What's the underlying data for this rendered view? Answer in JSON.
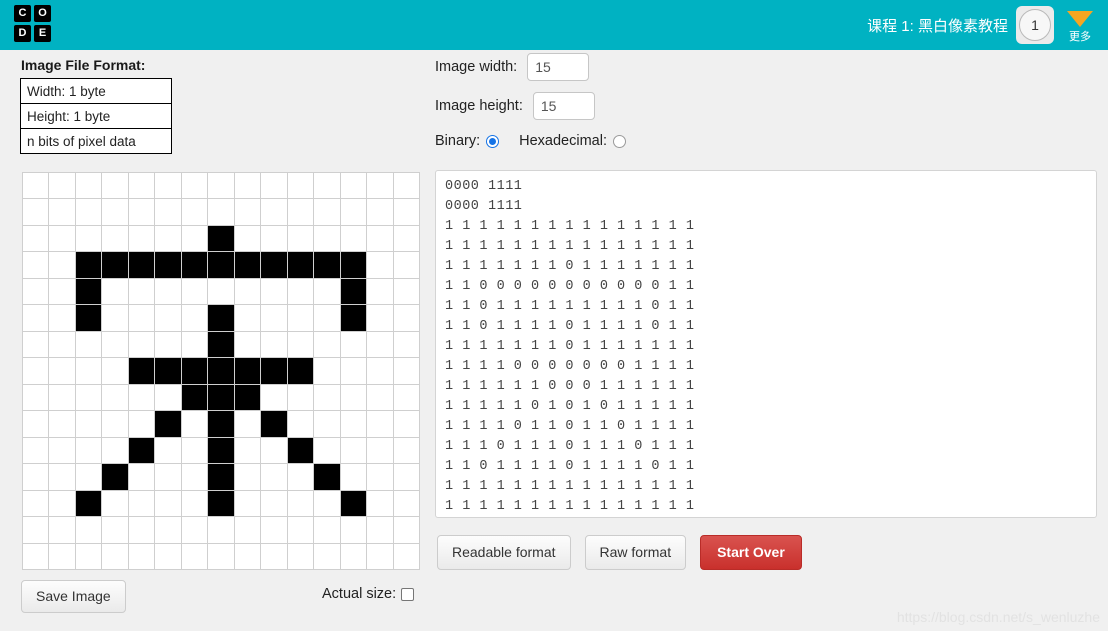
{
  "header": {
    "logo_letters": [
      "C",
      "O",
      "D",
      "E"
    ],
    "lesson_title": "课程 1: 黑白像素教程",
    "lesson_number": "1",
    "more_label": "更多",
    "background_color": "#00b2c2",
    "caret_color": "#f5a623"
  },
  "left_panel": {
    "format_title": "Image File Format:",
    "format_rows": [
      "Width: 1 byte",
      "Height: 1 byte",
      "n bits of pixel data"
    ],
    "save_image_label": "Save Image",
    "actual_size_label": "Actual size:",
    "actual_size_checked": false
  },
  "right_panel": {
    "width_label": "Image width:",
    "width_value": "15",
    "height_label": "Image height:",
    "height_value": "15",
    "binary_label": "Binary:",
    "hexadecimal_label": "Hexadecimal:",
    "binary_selected": true,
    "hexadecimal_selected": false,
    "buttons": {
      "readable_format": "Readable format",
      "raw_format": "Raw format",
      "start_over": "Start Over",
      "start_over_color": "#c9302c"
    }
  },
  "binary_output": {
    "header_lines": [
      "0000 1111",
      "0000 1111"
    ],
    "pixel_lines": [
      "1 1 1 1 1 1 1 1 1 1 1 1 1 1 1",
      "1 1 1 1 1 1 1 1 1 1 1 1 1 1 1",
      "1 1 1 1 1 1 1 0 1 1 1 1 1 1 1",
      "1 1 0 0 0 0 0 0 0 0 0 0 0 1 1",
      "1 1 0 1 1 1 1 1 1 1 1 1 0 1 1",
      "1 1 0 1 1 1 1 0 1 1 1 1 0 1 1",
      "1 1 1 1 1 1 1 0 1 1 1 1 1 1 1",
      "1 1 1 1 0 0 0 0 0 0 0 1 1 1 1",
      "1 1 1 1 1 1 0 0 0 1 1 1 1 1 1",
      "1 1 1 1 1 0 1 0 1 0 1 1 1 1 1",
      "1 1 1 1 0 1 1 0 1 1 0 1 1 1 1",
      "1 1 1 0 1 1 1 0 1 1 1 0 1 1 1",
      "1 1 0 1 1 1 1 0 1 1 1 1 0 1 1",
      "1 1 1 1 1 1 1 1 1 1 1 1 1 1 1",
      "1 1 1 1 1 1 1 1 1 1 1 1 1 1 1"
    ]
  },
  "pixel_grid": {
    "width": 15,
    "height": 15,
    "on_color": "#000000",
    "off_color": "#ffffff",
    "rows": [
      "111111111111111",
      "111111111111111",
      "111111101111111",
      "110000000000011",
      "110111111111011",
      "110111101111011",
      "111111101111111",
      "111100000001111",
      "111111000111111",
      "111110101011111",
      "111101101101111",
      "111011101110111",
      "110111101111011",
      "111111111111111",
      "111111111111111"
    ]
  },
  "watermark": "https://blog.csdn.net/s_wenluzhe"
}
